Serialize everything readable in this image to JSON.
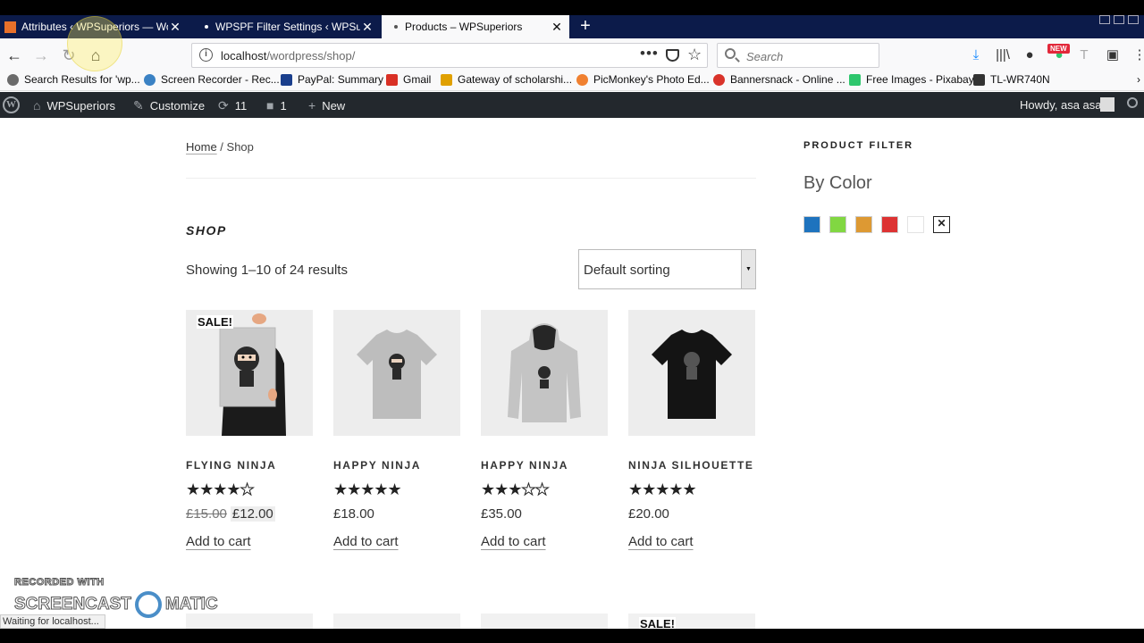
{
  "browser": {
    "tabs": [
      {
        "title": "Attributes ‹ WPSuperiors — Wo",
        "active": false
      },
      {
        "title": "WPSPF Filter Settings ‹ WPSupe",
        "active": false
      },
      {
        "title": "Products – WPSuperiors",
        "active": true
      }
    ],
    "url_host": "localhost",
    "url_path": "/wordpress/shop/",
    "search_placeholder": "Search",
    "new_badge": "NEW",
    "bookmarks": [
      {
        "label": "Search Results for 'wp...",
        "color": "#6b6b6b"
      },
      {
        "label": "Screen Recorder - Rec...",
        "color": "#3b82c4"
      },
      {
        "label": "PayPal: Summary",
        "color": "#1a3e8c"
      },
      {
        "label": "Gmail",
        "color": "#d93025"
      },
      {
        "label": "Gateway of scholarshi...",
        "color": "#e0a000"
      },
      {
        "label": "PicMonkey's Photo Ed...",
        "color": "#f08030"
      },
      {
        "label": "Bannersnack - Online ...",
        "color": "#d9332a"
      },
      {
        "label": "Free Images - Pixabay",
        "color": "#2ec66d"
      },
      {
        "label": "TL-WR740N",
        "color": "#333333"
      }
    ],
    "status_text": "Waiting for localhost..."
  },
  "adminbar": {
    "site_name": "WPSuperiors",
    "customize": "Customize",
    "updates": "11",
    "comments": "1",
    "new": "New",
    "howdy": "Howdy, asa asas"
  },
  "breadcrumb": {
    "home": "Home",
    "sep": " / ",
    "current": "Shop"
  },
  "shop": {
    "title": "SHOP",
    "result_count": "Showing 1–10 of 24 results",
    "sorting": "Default sorting",
    "sale_badge": "SALE!",
    "products": [
      {
        "name": "FLYING NINJA",
        "rating": 4,
        "old_price": "£15.00",
        "price": "£12.00",
        "on_sale": true,
        "add_to_cart": "Add to cart"
      },
      {
        "name": "HAPPY NINJA",
        "rating": 5,
        "old_price": "",
        "price": "£18.00",
        "on_sale": false,
        "add_to_cart": "Add to cart"
      },
      {
        "name": "HAPPY NINJA",
        "rating": 3,
        "old_price": "",
        "price": "£35.00",
        "on_sale": false,
        "add_to_cart": "Add to cart"
      },
      {
        "name": "NINJA SILHOUETTE",
        "rating": 5,
        "old_price": "",
        "price": "£20.00",
        "on_sale": false,
        "add_to_cart": "Add to cart"
      }
    ]
  },
  "sidebar": {
    "widget_title": "PRODUCT FILTER",
    "filter_label": "By Color",
    "swatch_colors": [
      "#1e73be",
      "#81d742",
      "#dd9933",
      "#dd3333",
      "#ffffff"
    ]
  },
  "watermark": {
    "line1": "RECORDED WITH",
    "left": "SCREENCAST",
    "right": "MATIC"
  }
}
